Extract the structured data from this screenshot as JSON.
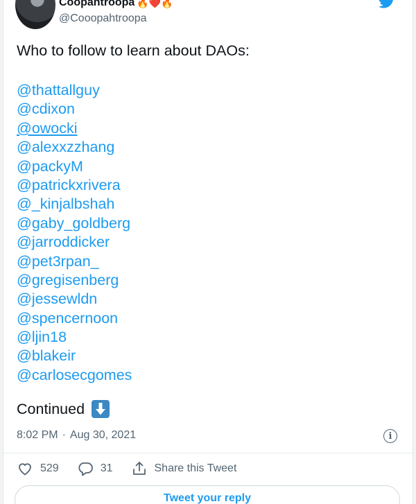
{
  "user": {
    "display_name": "Coopahtroopa",
    "name_emojis": "🔥❤️🔥",
    "handle": "@Cooopahtroopa",
    "avatar": "avatar-photo",
    "brand_icon": "twitter-bird-icon"
  },
  "tweet": {
    "intro": "Who to follow to learn about DAOs:",
    "mentions": [
      "@thattallguy",
      "@cdixon",
      "@owocki",
      "@alexxzzhang",
      "@packyM",
      "@patrickxrivera",
      "@_kinjalbshah",
      "@gaby_goldberg",
      "@jarroddicker",
      "@pet3rpan_",
      "@gregisenberg",
      "@jessewldn",
      "@spencernoon",
      "@ljin18",
      "@blakeir",
      "@carlosecgomes"
    ],
    "continued": "Continued",
    "continued_icon": "down-arrow-button-emoji",
    "time": "8:02 PM",
    "separator": "·",
    "date": "Aug 30, 2021"
  },
  "actions": {
    "likes": "529",
    "replies": "31",
    "share_label": "Share this Tweet"
  },
  "reply_button": "Tweet your reply",
  "colors": {
    "link": "#1d9bf0",
    "text": "#0f1419",
    "muted": "#536471"
  }
}
